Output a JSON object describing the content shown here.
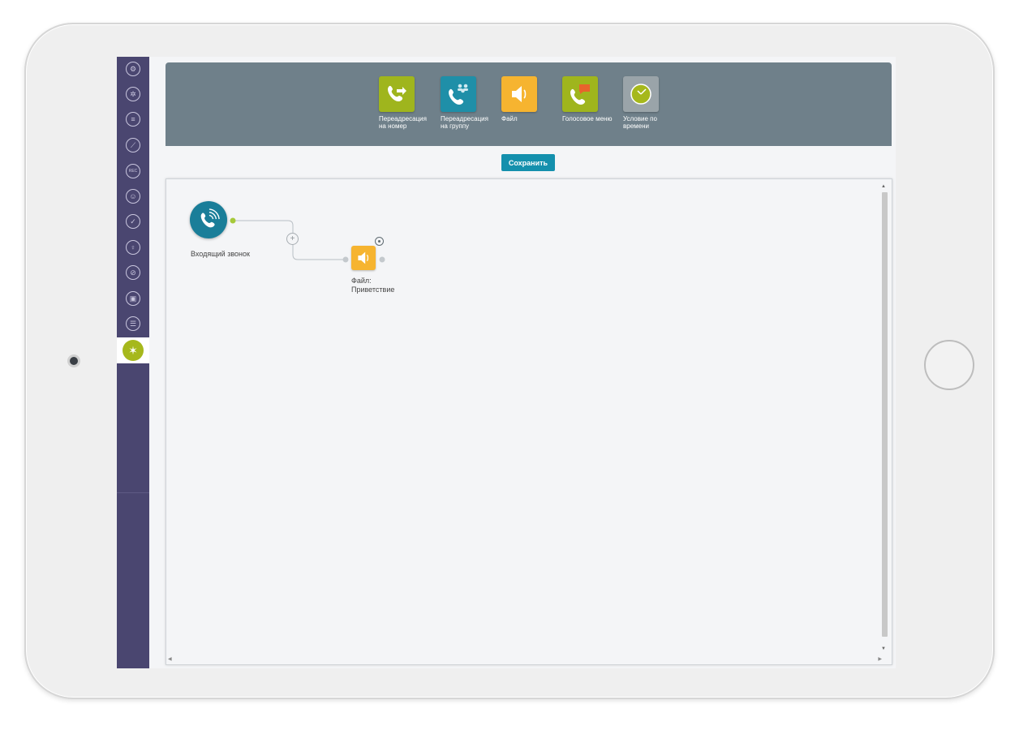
{
  "toolbar": {
    "tools": [
      {
        "label": "Переадресация\nна номер",
        "icon": "phone-forward-icon",
        "color": "#9fb51d"
      },
      {
        "label": "Переадресация\nна группу",
        "icon": "phone-group-icon",
        "color": "#1f8fa8"
      },
      {
        "label": "Файл",
        "icon": "speaker-icon",
        "color": "#f6b430"
      },
      {
        "label": "Голосовое меню",
        "icon": "phone-chat-icon",
        "color": "#9fb51d"
      },
      {
        "label": "Условие по\nвремени",
        "icon": "clock-icon",
        "color": "#9aa4a9"
      }
    ]
  },
  "save_label": "Сохранить",
  "flow": {
    "incoming_label": "Входящий звонок",
    "file_node_label": "Файл:\nПриветствие"
  },
  "sidebar": {
    "items": [
      "settings-icon",
      "gear-icon",
      "chat-icon",
      "chart-icon",
      "rec-icon",
      "user-icon",
      "shield-check-icon",
      "microphone-icon",
      "no-call-icon",
      "wallet-icon",
      "list-icon",
      "magic-wand-icon"
    ],
    "rec_text": "REC",
    "active_index": 11
  },
  "colors": {
    "sidebar": "#4a4670",
    "toolbar": "#6f808a",
    "save": "#1490ad",
    "accent": "#a6b81c"
  }
}
